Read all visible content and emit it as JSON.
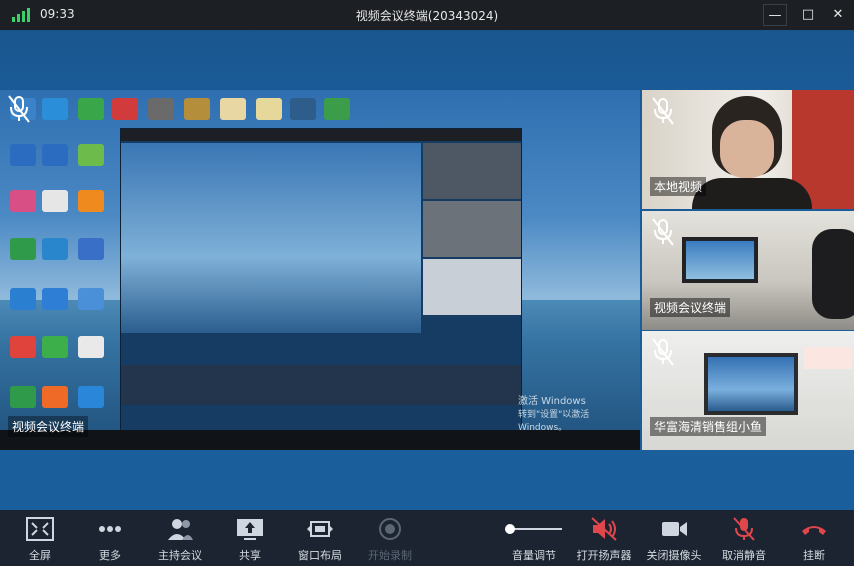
{
  "titlebar": {
    "time": "09:33",
    "title": "视频会议终端(20343024)"
  },
  "window_controls": {
    "minimize": "—",
    "maximize": "□",
    "close": "✕"
  },
  "main_video": {
    "label": "视频会议终端",
    "watermark_title": "激活 Windows",
    "watermark_sub": "转到\"设置\"以激活 Windows。"
  },
  "tiles": [
    {
      "label": "本地视频",
      "muted": true
    },
    {
      "label": "视频会议终端",
      "muted": true
    },
    {
      "label": "华富海清销售组小鱼",
      "muted": true
    }
  ],
  "toolbar": {
    "fullscreen": "全屏",
    "more": "更多",
    "host": "主持会议",
    "share": "共享",
    "layout": "窗口布局",
    "record": "开始录制",
    "volume": "音量调节",
    "speaker": "打开扬声器",
    "camera": "关闭摄像头",
    "unmute": "取消静音",
    "hangup": "挂断"
  },
  "colors": {
    "accent_red": "#e0474c",
    "signal_green": "#3ad06a",
    "toolbar_bg": "#1b2430"
  }
}
